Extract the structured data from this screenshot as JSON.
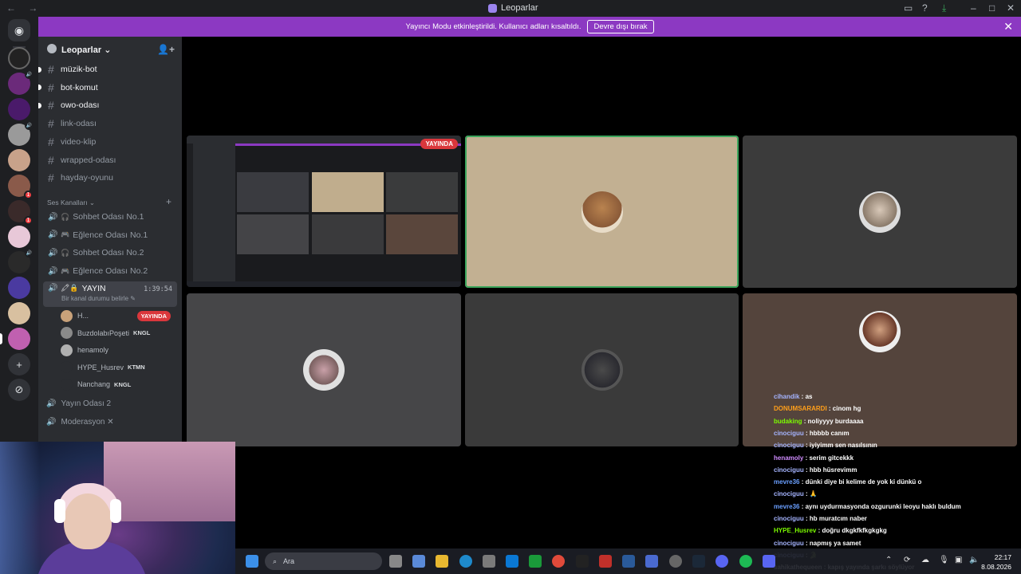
{
  "window": {
    "title": "Leoparlar",
    "nav": "← →"
  },
  "banner": {
    "text": "Yayıncı Modu etkinleştirildi. Kullanıcı adları kısaltıldı.",
    "button": "Devre dışı bırak"
  },
  "server": {
    "name": "Leoparlar"
  },
  "text_channels": [
    {
      "name": "müzik-bot",
      "unread": true
    },
    {
      "name": "bot-komut",
      "unread": true
    },
    {
      "name": "owo-odası",
      "unread": true
    },
    {
      "name": "link-odası",
      "unread": false
    },
    {
      "name": "video-klip",
      "unread": false
    },
    {
      "name": "wrapped-odası",
      "unread": false
    },
    {
      "name": "hayday-oyunu",
      "unread": false
    }
  ],
  "voice_category": "Ses Kanalları",
  "voice_channels": [
    {
      "name": "Sohbet Odası No.1",
      "icon": "headphones-icon"
    },
    {
      "name": "Eğlence Odası No.1",
      "icon": "gamepad-icon"
    },
    {
      "name": "Sohbet Odası No.2",
      "icon": "headphones-icon"
    },
    {
      "name": "Eğlence Odası No.2",
      "icon": "gamepad-icon"
    }
  ],
  "active_channel": {
    "name": "YAYIN",
    "timer": "1:39:54",
    "status_placeholder": "Bir kanal durumu belirle"
  },
  "members": [
    {
      "name": "H...",
      "tag": "",
      "live": "YAYINDA",
      "color": "#c9a27a"
    },
    {
      "name": "BuzdolabıPoşeti",
      "tag": "KNGL",
      "live": "",
      "color": "#8a8a8a"
    },
    {
      "name": "henamoly",
      "tag": "",
      "live": "",
      "color": "#b0b0b0"
    },
    {
      "name": "HYPE_Husrev",
      "tag": "KTMN",
      "live": "",
      "color": "#2b2d31"
    },
    {
      "name": "Nanchang",
      "tag": "KNGL",
      "live": "",
      "color": "#2b2d31"
    }
  ],
  "other_channels": [
    {
      "name": "Yayın Odası 2"
    },
    {
      "name": "Moderasyon ✕"
    }
  ],
  "stage": {
    "live_label": "YAYINDA"
  },
  "chat": [
    {
      "user": "cihandik",
      "text": "as",
      "color": "#a5b4ff"
    },
    {
      "user": "DONUMSARARDI",
      "text": "cinom hg",
      "color": "#ff9f1a"
    },
    {
      "user": "budaking",
      "text": "noliyyyy burdaaaa",
      "color": "#7cfc00"
    },
    {
      "user": "cinociguu",
      "text": "hbbbb canım",
      "color": "#a5b4ff"
    },
    {
      "user": "cinociguu",
      "text": "iyiyimm sen nasılsının",
      "color": "#a5b4ff"
    },
    {
      "user": "henamoly",
      "text": "serim gitcekkk",
      "color": "#d08cff"
    },
    {
      "user": "cinociguu",
      "text": "hbb hüsrevimm",
      "color": "#a5b4ff"
    },
    {
      "user": "mevre36",
      "text": "dünki diye bi kelime de yok ki dünkü o",
      "color": "#6a9fff"
    },
    {
      "user": "cinociguu",
      "text": "🙏",
      "color": "#a5b4ff"
    },
    {
      "user": "mevre36",
      "text": "aynı uydurmasyonda ozgurunki leoyu haklı buldum",
      "color": "#6a9fff"
    },
    {
      "user": "cinociguu",
      "text": "hb muratcım naber",
      "color": "#a5b4ff"
    },
    {
      "user": "HYPE_Husrev",
      "text": "doğru dkgkfkfkgkgkg",
      "color": "#7cfc00"
    },
    {
      "user": "cinociguu",
      "text": "napmış ya samet",
      "color": "#a5b4ff"
    },
    {
      "user": "cinociguu",
      "text": "🐊",
      "color": "#a5b4ff"
    },
    {
      "user": "sahikathequeen",
      "text": "kapış yayında şarkı söylüyor",
      "color": "#ffffff"
    }
  ],
  "taskbar": {
    "search_placeholder": "Ara",
    "time": "22:17",
    "date": "8.08.2026"
  }
}
